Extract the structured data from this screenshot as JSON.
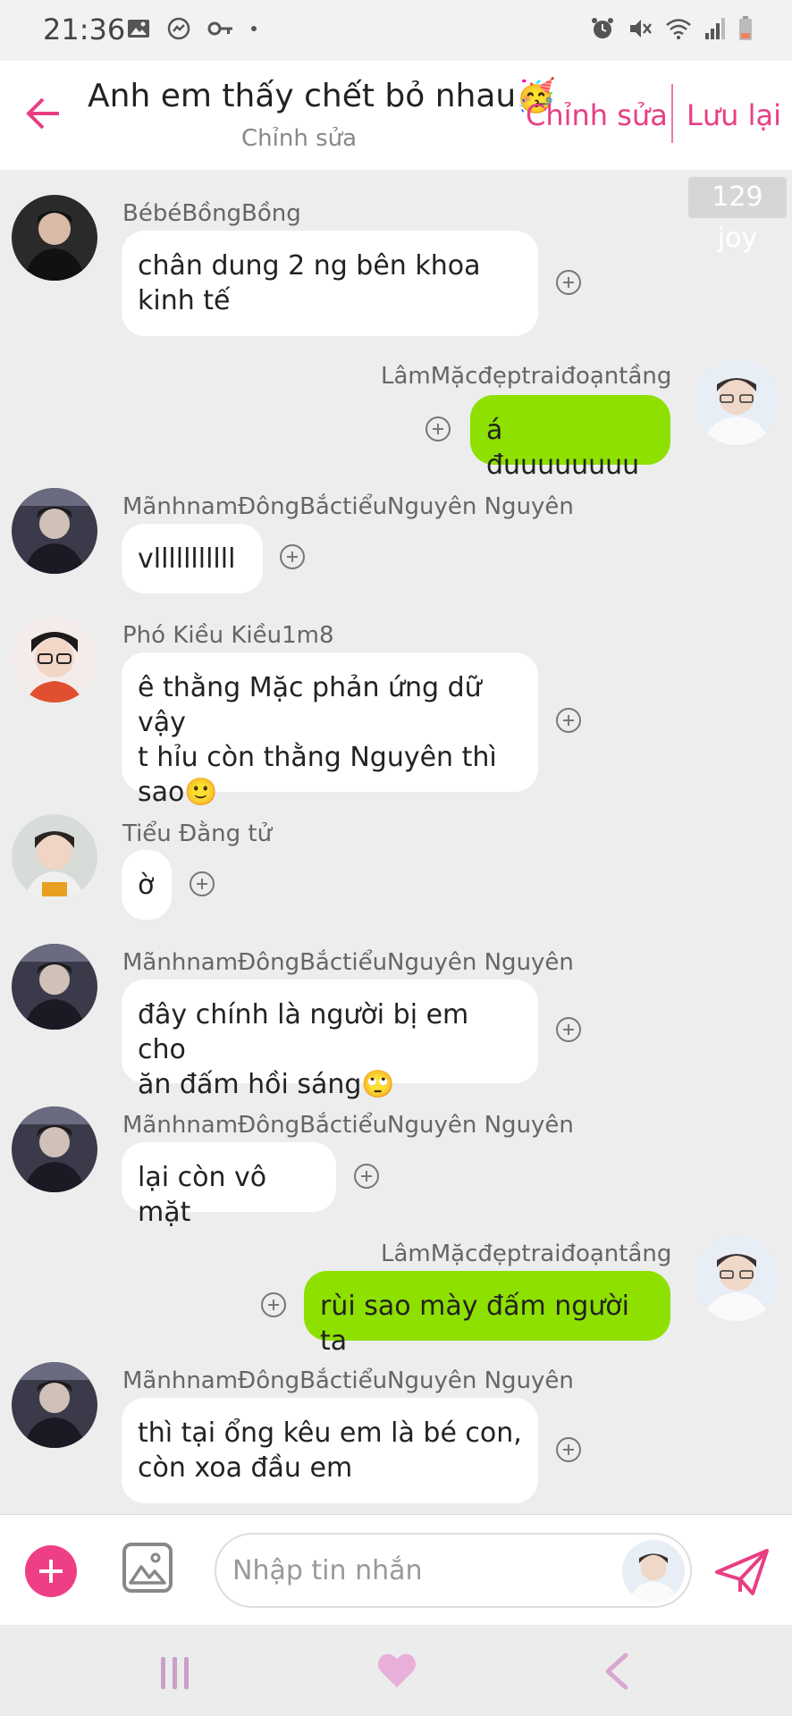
{
  "status": {
    "time": "21:36"
  },
  "header": {
    "title": "Anh em thấy chết bỏ nhau🥳",
    "subtitle": "Chỉnh sửa",
    "edit_label": "Chỉnh sửa",
    "save_label": "Lưu lại"
  },
  "joy_badge": "129 joy",
  "messages": [
    {
      "sender": "BébéBồngBồng",
      "text_lines": [
        "chân dung 2 ng bên khoa",
        "kinh tế"
      ],
      "direction": "in"
    },
    {
      "sender": "LâmMặcđẹptraiđoạntầng",
      "text_lines": [
        "á đuuuuuuuu"
      ],
      "direction": "out"
    },
    {
      "sender": "MãnhnamĐôngBắctiểuNguyên Nguyên",
      "text_lines": [
        "vlllllllllll"
      ],
      "direction": "in"
    },
    {
      "sender": "Phó Kiều Kiều1m8",
      "text_lines": [
        "ê thằng Mặc phản ứng dữ vậy",
        "t hỉu còn thằng Nguyên thì",
        "sao🙂"
      ],
      "direction": "in"
    },
    {
      "sender": "Tiểu Đằng tử",
      "text_lines": [
        "ờ"
      ],
      "direction": "in"
    },
    {
      "sender": "MãnhnamĐôngBắctiểuNguyên Nguyên",
      "text_lines": [
        "đây chính là người bị em cho",
        "ăn đấm hồi sáng🙄"
      ],
      "direction": "in"
    },
    {
      "sender": "MãnhnamĐôngBắctiểuNguyên Nguyên",
      "text_lines": [
        "lại còn vô mặt"
      ],
      "direction": "in"
    },
    {
      "sender": "LâmMặcđẹptraiđoạntầng",
      "text_lines": [
        "rùi sao mày đấm người ta"
      ],
      "direction": "out"
    },
    {
      "sender": "MãnhnamĐôngBắctiểuNguyên Nguyên",
      "text_lines": [
        "thì tại ổng kêu em là bé con,",
        "còn xoa đầu em"
      ],
      "direction": "in"
    }
  ],
  "input": {
    "placeholder": "Nhập tin nhắn"
  },
  "colors": {
    "accent": "#e83e83",
    "outgoing_bubble": "#8ee000",
    "incoming_bubble": "#ffffff",
    "background": "#ededed"
  },
  "icons": [
    "back-arrow-icon",
    "add-icon",
    "image-icon",
    "send-icon",
    "recent-apps-icon",
    "heart-home-icon",
    "nav-back-icon"
  ]
}
